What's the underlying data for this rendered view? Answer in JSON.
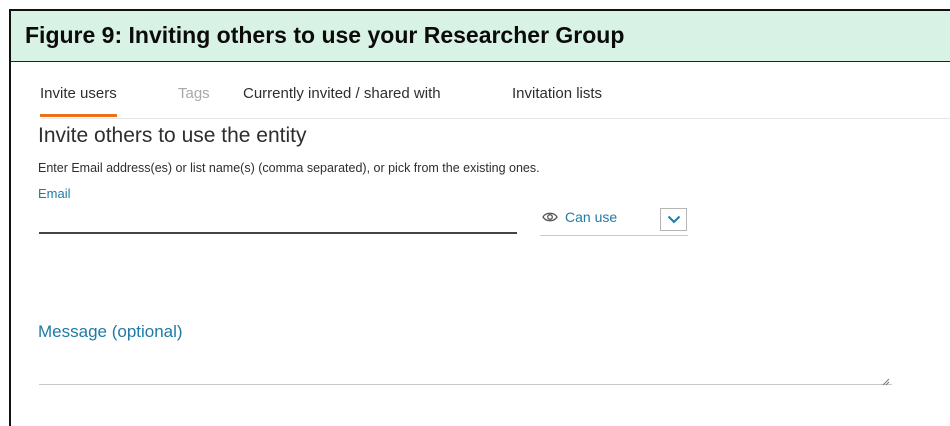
{
  "banner": {
    "title": "Figure 9: Inviting others to use your Researcher Group"
  },
  "tabs": [
    {
      "label": "Invite users",
      "active": true,
      "disabled": false
    },
    {
      "label": "Tags",
      "active": false,
      "disabled": true
    },
    {
      "label": "Currently invited / shared with",
      "active": false,
      "disabled": false
    },
    {
      "label": "Invitation lists",
      "active": false,
      "disabled": false
    }
  ],
  "invite": {
    "heading": "Invite others to use the entity",
    "hint": "Enter Email address(es) or list name(s) (comma separated), or pick from the existing ones.",
    "email_label": "Email",
    "email_value": "",
    "permission": {
      "icon": "eye-icon",
      "selected": "Can use",
      "dropdown_icon": "chevron-down-icon"
    },
    "message_label": "Message (optional)",
    "message_value": ""
  },
  "colors": {
    "banner_bg": "#d9f2e6",
    "accent_blue": "#1f7aa4",
    "tab_active_underline": "#e9711c",
    "disabled_text": "#a7a7a7"
  }
}
